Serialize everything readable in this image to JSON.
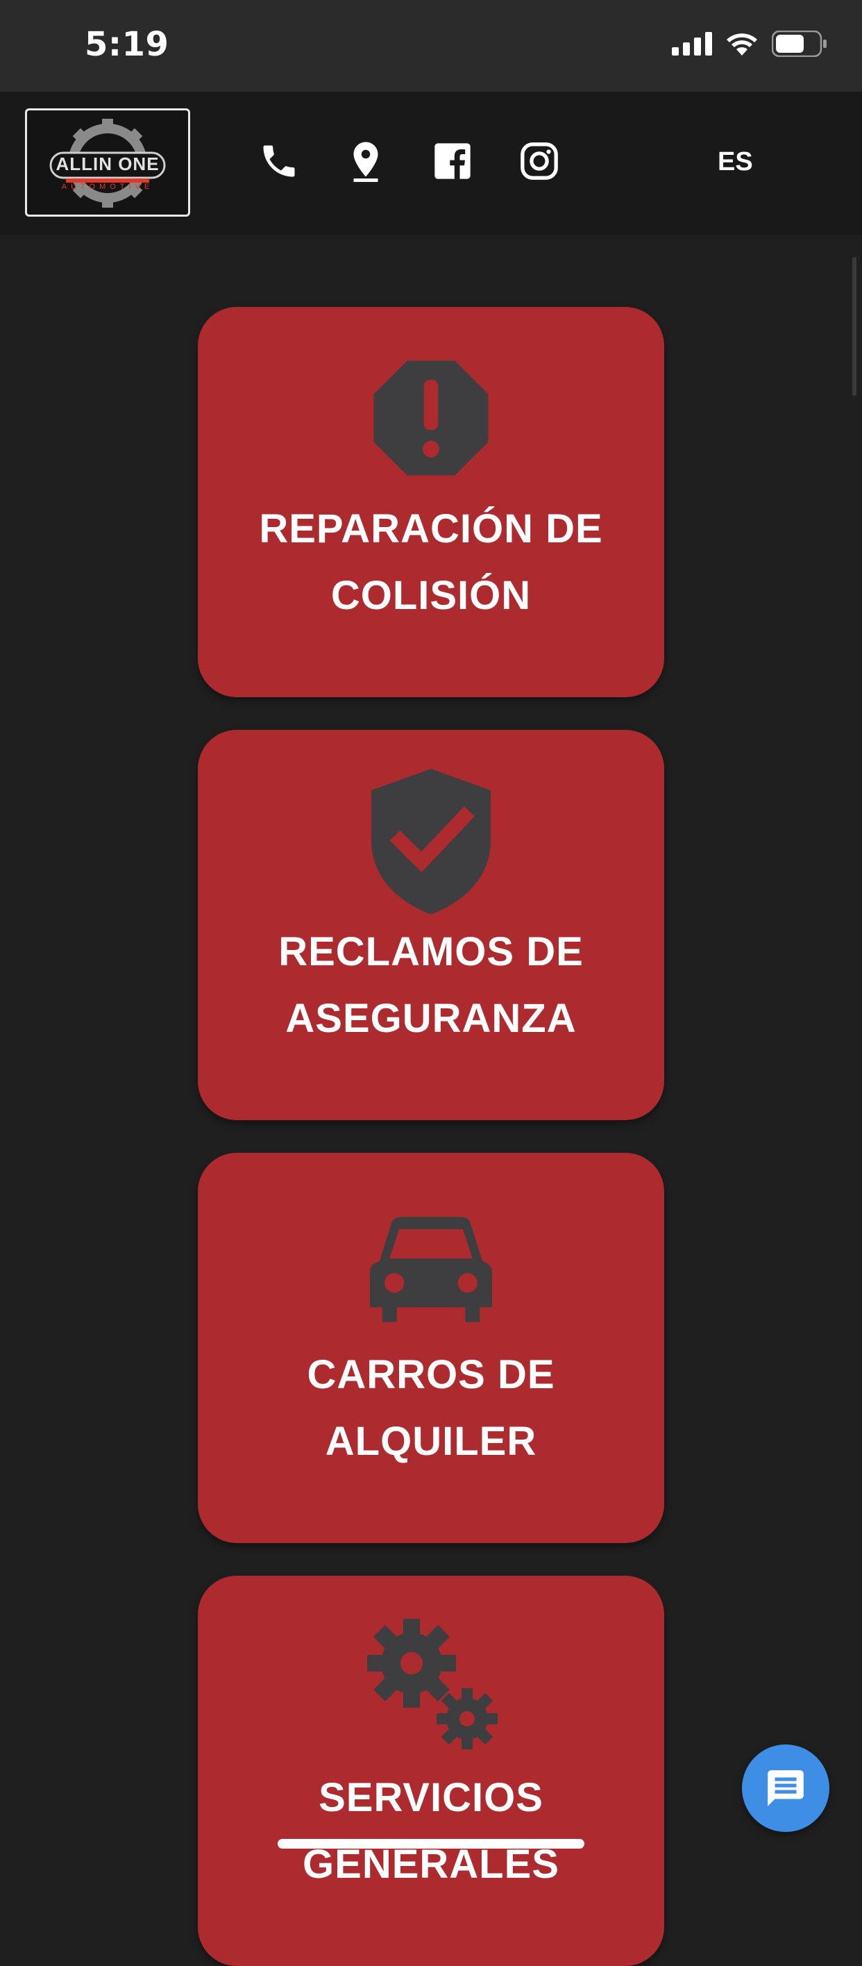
{
  "status_bar": {
    "time": "5:19"
  },
  "header": {
    "logo_text": "ALLIN ONE",
    "logo_sub": "AUTOMOTIVE",
    "language": "ES",
    "icons": [
      "phone-icon",
      "location-pin-icon",
      "facebook-icon",
      "instagram-icon"
    ]
  },
  "cards": [
    {
      "title": "REPARACIÓN DE COLISIÓN",
      "icon": "warning-octagon-icon"
    },
    {
      "title": "RECLAMOS DE ASEGURANZA",
      "icon": "shield-check-icon"
    },
    {
      "title": "CARROS DE ALQUILER",
      "icon": "car-icon"
    },
    {
      "title": "SERVICIOS GENERALES",
      "icon": "gears-icon"
    }
  ],
  "colors": {
    "background": "#1f1f20",
    "card": "#ad2b2e",
    "card_icon": "#3e3e40",
    "chat_button": "#3e8ee5"
  }
}
